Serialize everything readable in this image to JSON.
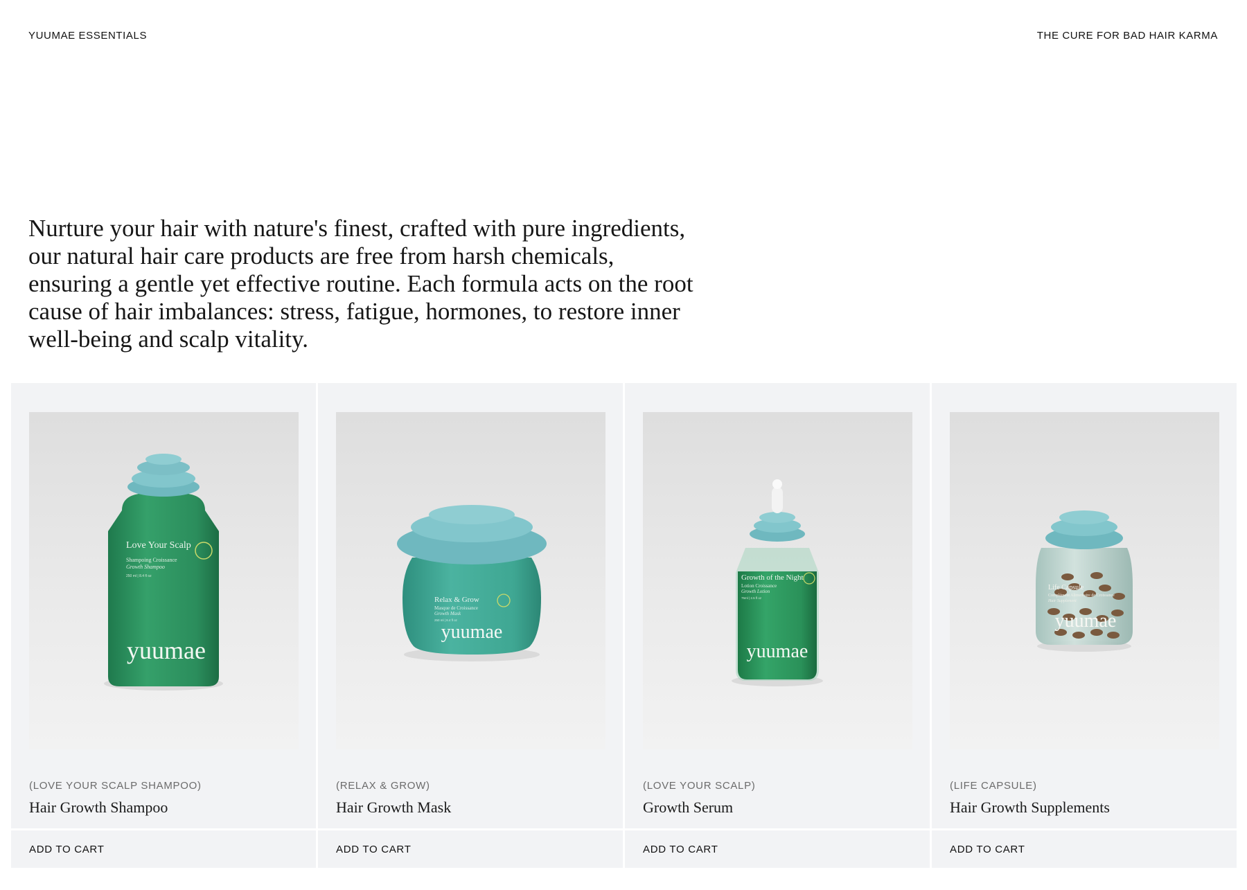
{
  "header": {
    "brand": "YUUMAE ESSENTIALS",
    "tagline": "THE CURE FOR BAD HAIR KARMA"
  },
  "intro": {
    "text": "Nurture your hair with nature's finest, crafted with pure ingredients, our natural hair care products are free from harsh chemicals, ensuring a gentle yet effective routine. Each formula acts on the root cause of hair imbalances: stress, fatigue, hormones, to restore inner well-being and scalp vitality."
  },
  "products": [
    {
      "subtitle": "(LOVE YOUR SCALP SHAMPOO)",
      "title": "Hair Growth Shampoo",
      "cart_label": "ADD TO CART",
      "image_icon": "shampoo-bottle-icon",
      "label_brand": "yuumae",
      "label_name": "Love Your Scalp",
      "label_sub": "Shampoing Croissance",
      "label_sub2": "Growth Shampoo",
      "label_size": "250 ml | 8.4 fl oz",
      "body_color": "#2f9563",
      "cap_color": "#7cc1c7"
    },
    {
      "subtitle": "(RELAX & GROW)",
      "title": "Hair Growth Mask",
      "cart_label": "ADD TO CART",
      "image_icon": "mask-jar-icon",
      "label_brand": "yuumae",
      "label_name": "Relax & Grow",
      "label_sub": "Masque de Croissance",
      "label_sub2": "Growth Mask",
      "label_size": "250 ml | 8.4 fl oz",
      "body_color": "#3fa896",
      "cap_color": "#7cc1c7"
    },
    {
      "subtitle": "(LOVE YOUR SCALP)",
      "title": "Growth Serum",
      "cart_label": "ADD TO CART",
      "image_icon": "serum-dropper-icon",
      "label_brand": "yuumae",
      "label_name": "Growth of the Night",
      "label_sub": "Lotion Croissance",
      "label_sub2": "Growth Lotion",
      "label_size": "75ml | 2.5 fl oz",
      "body_color": "#2d9b5e",
      "cap_color": "#7cc1c7"
    },
    {
      "subtitle": "(LIFE CAPSULE)",
      "title": "Hair Growth Supplements",
      "cart_label": "ADD TO CART",
      "image_icon": "capsule-jar-icon",
      "label_brand": "yuumae",
      "label_name": "Life Capsule",
      "label_sub": "Complément Alimentaire de Croissance",
      "label_sub2": "Hair Supplement",
      "label_size": "",
      "body_color": "#a9c5bf",
      "cap_color": "#7cc1c7"
    }
  ]
}
